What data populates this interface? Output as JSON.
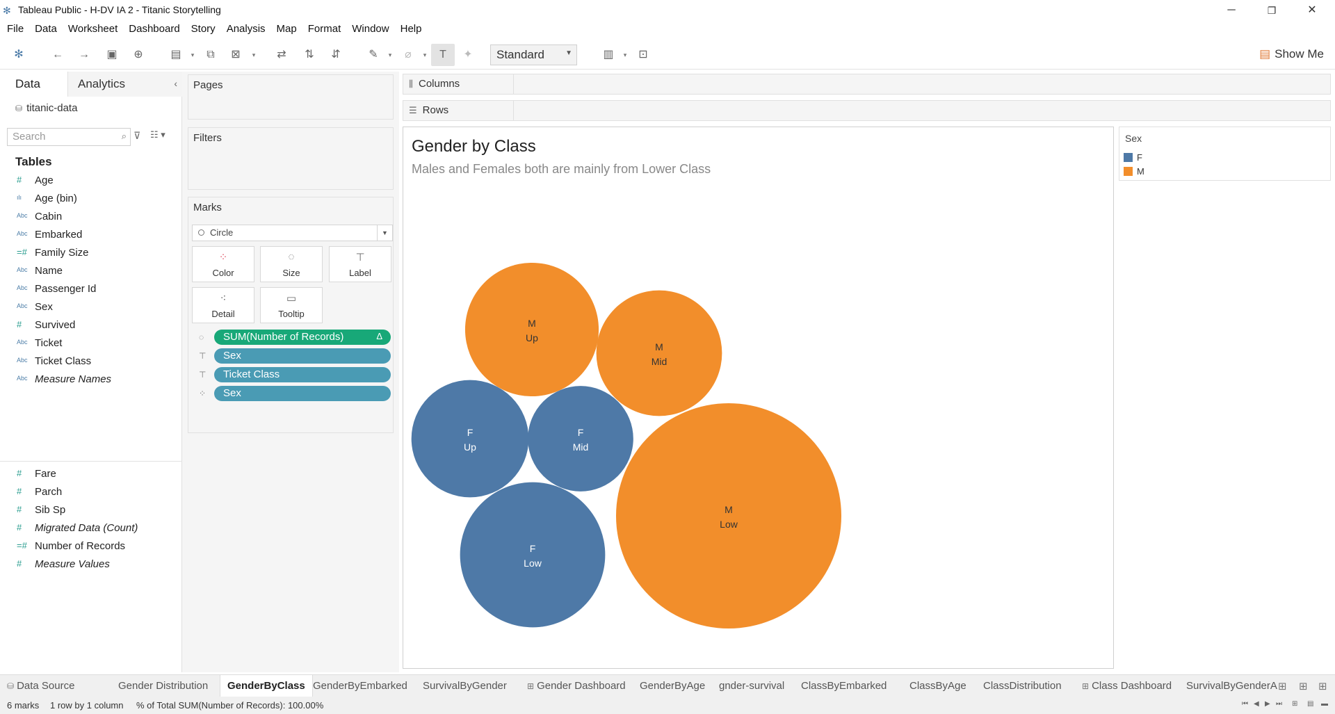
{
  "window": {
    "title": "Tableau Public - H-DV IA 2 - Titanic Storytelling",
    "minimize": "─",
    "restore": "❐",
    "close": "✕"
  },
  "menu": [
    "File",
    "Data",
    "Worksheet",
    "Dashboard",
    "Story",
    "Analysis",
    "Map",
    "Format",
    "Window",
    "Help"
  ],
  "toolbar": {
    "fit_select": "Standard",
    "show_me": "Show Me"
  },
  "left_pane": {
    "tab_data": "Data",
    "tab_analytics": "Analytics",
    "datasource": "titanic-data",
    "search_placeholder": "Search",
    "tables_heading": "Tables",
    "dimensions": [
      {
        "type": "#",
        "name": "Age",
        "italic": false
      },
      {
        "type": "bin",
        "name": "Age (bin)",
        "italic": false
      },
      {
        "type": "Abc",
        "name": "Cabin",
        "italic": false
      },
      {
        "type": "Abc",
        "name": "Embarked",
        "italic": false
      },
      {
        "type": "=#",
        "name": "Family Size",
        "italic": false
      },
      {
        "type": "Abc",
        "name": "Name",
        "italic": false
      },
      {
        "type": "Abc",
        "name": "Passenger Id",
        "italic": false
      },
      {
        "type": "Abc",
        "name": "Sex",
        "italic": false
      },
      {
        "type": "#",
        "name": "Survived",
        "italic": false
      },
      {
        "type": "Abc",
        "name": "Ticket",
        "italic": false
      },
      {
        "type": "Abc",
        "name": "Ticket Class",
        "italic": false
      },
      {
        "type": "Abc",
        "name": "Measure Names",
        "italic": true
      }
    ],
    "measures": [
      {
        "type": "#",
        "name": "Fare",
        "italic": false
      },
      {
        "type": "#",
        "name": "Parch",
        "italic": false
      },
      {
        "type": "#",
        "name": "Sib Sp",
        "italic": false
      },
      {
        "type": "#",
        "name": "Migrated Data (Count)",
        "italic": true
      },
      {
        "type": "=#",
        "name": "Number of Records",
        "italic": false
      },
      {
        "type": "#",
        "name": "Measure Values",
        "italic": true
      }
    ]
  },
  "cards": {
    "pages": "Pages",
    "filters": "Filters",
    "marks": "Marks",
    "mark_type": "Circle",
    "buttons": [
      "Color",
      "Size",
      "Label",
      "Detail",
      "Tooltip"
    ],
    "pills": [
      {
        "icon": "size-icon",
        "label": "SUM(Number of Records)",
        "green": true,
        "delta": "Δ"
      },
      {
        "icon": "label-icon",
        "label": "Sex",
        "green": false,
        "delta": ""
      },
      {
        "icon": "label-icon",
        "label": "Ticket Class",
        "green": false,
        "delta": ""
      },
      {
        "icon": "color-icon",
        "label": "Sex",
        "green": false,
        "delta": ""
      }
    ]
  },
  "shelves": {
    "columns": "Columns",
    "rows": "Rows"
  },
  "viz": {
    "title": "Gender by Class",
    "subtitle": "Males and Females both are mainly from Lower Class"
  },
  "legend": {
    "title": "Sex",
    "items": [
      {
        "label": "F",
        "color": "#4e79a7"
      },
      {
        "label": "M",
        "color": "#f28e2b"
      }
    ]
  },
  "chart_data": {
    "type": "packed-bubble",
    "measure": "SUM(Number of Records)",
    "color_field": "Sex",
    "label_fields": [
      "Sex",
      "Ticket Class"
    ],
    "bubbles": [
      {
        "sex": "M",
        "class": "Up",
        "value": 122
      },
      {
        "sex": "M",
        "class": "Mid",
        "value": 108
      },
      {
        "sex": "F",
        "class": "Up",
        "value": 94
      },
      {
        "sex": "F",
        "class": "Mid",
        "value": 76
      },
      {
        "sex": "F",
        "class": "Low",
        "value": 144
      },
      {
        "sex": "M",
        "class": "Low",
        "value": 347
      }
    ],
    "colors": {
      "F": "#4e79a7",
      "M": "#f28e2b"
    },
    "label_colors": {
      "F": "#ffffff",
      "M": "#333333"
    }
  },
  "sheet_tabs": [
    {
      "label": "Data Source",
      "icon": "⛁",
      "active": false
    },
    {
      "label": "Gender Distribution",
      "icon": "",
      "active": false
    },
    {
      "label": "GenderByClass",
      "icon": "",
      "active": true
    },
    {
      "label": "GenderByEmbarked",
      "icon": "",
      "active": false
    },
    {
      "label": "SurvivalByGender",
      "icon": "",
      "active": false
    },
    {
      "label": "Gender Dashboard",
      "icon": "⊞",
      "active": false
    },
    {
      "label": "GenderByAge",
      "icon": "",
      "active": false
    },
    {
      "label": "gnder-survival",
      "icon": "",
      "active": false
    },
    {
      "label": "ClassByEmbarked",
      "icon": "",
      "active": false
    },
    {
      "label": "ClassByAge",
      "icon": "",
      "active": false
    },
    {
      "label": "ClassDistribution",
      "icon": "",
      "active": false
    },
    {
      "label": "Class Dashboard",
      "icon": "⊞",
      "active": false
    },
    {
      "label": "SurvivalByGenderA",
      "icon": "",
      "active": false
    }
  ],
  "status": {
    "marks": "6 marks",
    "dims": "1 row by 1 column",
    "sum": "% of Total SUM(Number of Records): 100.00%"
  }
}
